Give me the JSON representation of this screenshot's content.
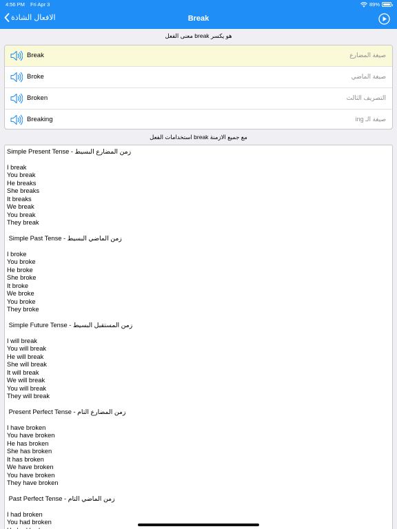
{
  "status_bar": {
    "time": "4:56 PM",
    "date": "Fri Apr 3",
    "battery": "89%",
    "wifi_icon": "wifi-icon",
    "battery_icon": "battery-icon"
  },
  "nav": {
    "back_label": "الافعال الشاذة",
    "title": "Break",
    "back_icon": "chevron-left-icon",
    "play_icon": "play-circle-icon"
  },
  "meaning_header": "معنى الفعل break هو يكسر",
  "forms": [
    {
      "word": "Break",
      "label": "صيغة المضارع",
      "highlighted": true
    },
    {
      "word": "Broke",
      "label": "صيغة الماضي",
      "highlighted": false
    },
    {
      "word": "Broken",
      "label": "التصريف الثالث",
      "highlighted": false
    },
    {
      "word": "Breaking",
      "label": "صيغة الـ ing",
      "highlighted": false
    }
  ],
  "usage_header": "استخدامات الفعل break مع جميع الازمنة",
  "tenses_text": "Simple Present Tense - زمن المضارع البسيط\n\nI break\nYou break\nHe breaks\nShe breaks\nIt breaks\nWe break\nYou break\nThey break\n\n Simple Past Tense - زمن الماضي البسيط\n\nI broke\nYou broke\nHe broke\nShe broke\nIt broke\nWe broke\nYou broke\nThey broke\n\n Simple Future Tense - زمن المستقبل البسيط\n\nI will break\nYou will break\nHe will break\nShe will break\nIt will break\nWe will break\nYou will break\nThey will break\n\n Present Perfect Tense - زمن المضارع التام\n\nI have broken\nYou have broken\nHe has broken\nShe has broken\nIt has broken\nWe have broken\nYou have broken\nThey have broken\n\n Past Perfect Tense - زمن الماضي التام\n\nI had broken\nYou had broken\nHe had broken",
  "colors": {
    "accent": "#1f8ff7",
    "highlight_row": "#fbfad8",
    "background": "#efeff4"
  }
}
